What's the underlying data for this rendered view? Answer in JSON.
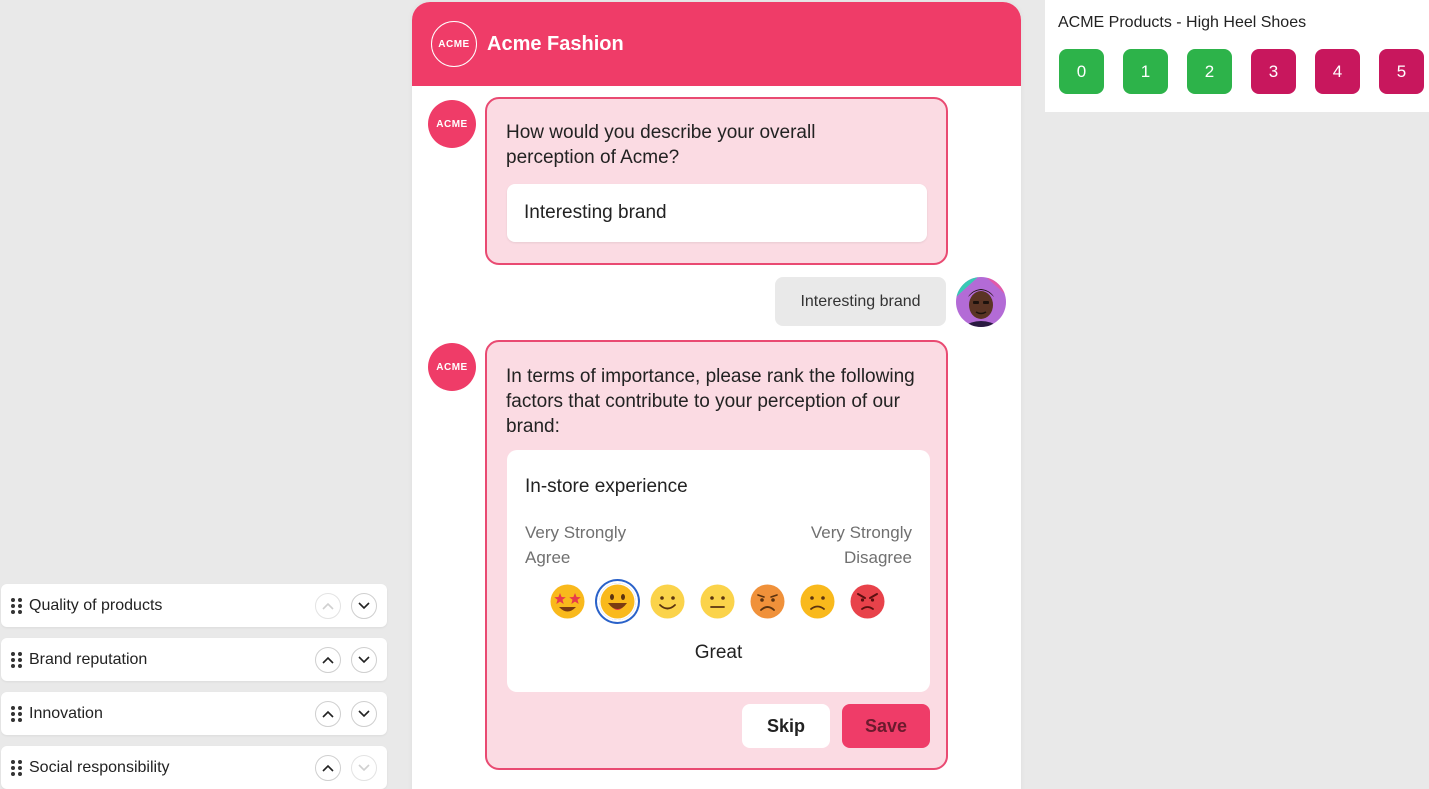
{
  "chat": {
    "brand_logo": "ACME",
    "brand_name": "Acme Fashion",
    "bot_avatar": "ACME",
    "q1": {
      "question": "How would you describe your overall perception of Acme?",
      "answer": "Interesting brand"
    },
    "user_reply": "Interesting brand",
    "q2": {
      "question": "In terms of importance, please rank the following factors that contribute to your perception of our brand:",
      "card_title": "In-store experience",
      "scale_left_line1": "Very Strongly",
      "scale_left_line2": "Agree",
      "scale_right_line1": "Very Strongly",
      "scale_right_line2": "Disagree",
      "selected_index": 1,
      "selected_label": "Great",
      "emojis": [
        "star-struck-icon",
        "grinning-icon",
        "smiling-icon",
        "neutral-icon",
        "worried-icon",
        "frowning-icon",
        "angry-icon"
      ]
    },
    "skip_label": "Skip",
    "save_label": "Save"
  },
  "nps": {
    "title": "ACME Products - High Heel Shoes",
    "options": [
      {
        "label": "0",
        "color": "#2db34a"
      },
      {
        "label": "1",
        "color": "#2db34a"
      },
      {
        "label": "2",
        "color": "#2db34a"
      },
      {
        "label": "3",
        "color": "#c8175d"
      },
      {
        "label": "4",
        "color": "#c8175d"
      },
      {
        "label": "5",
        "color": "#c8175d"
      }
    ]
  },
  "ranking": {
    "items": [
      {
        "label": "Quality of products"
      },
      {
        "label": "Brand reputation"
      },
      {
        "label": "Innovation"
      },
      {
        "label": "Social responsibility"
      }
    ]
  },
  "colors": {
    "brand": "#ef3c68",
    "bubble_bg": "#fbdbe3",
    "bubble_border": "#e94a72",
    "selected_ring": "#2a62c9"
  }
}
